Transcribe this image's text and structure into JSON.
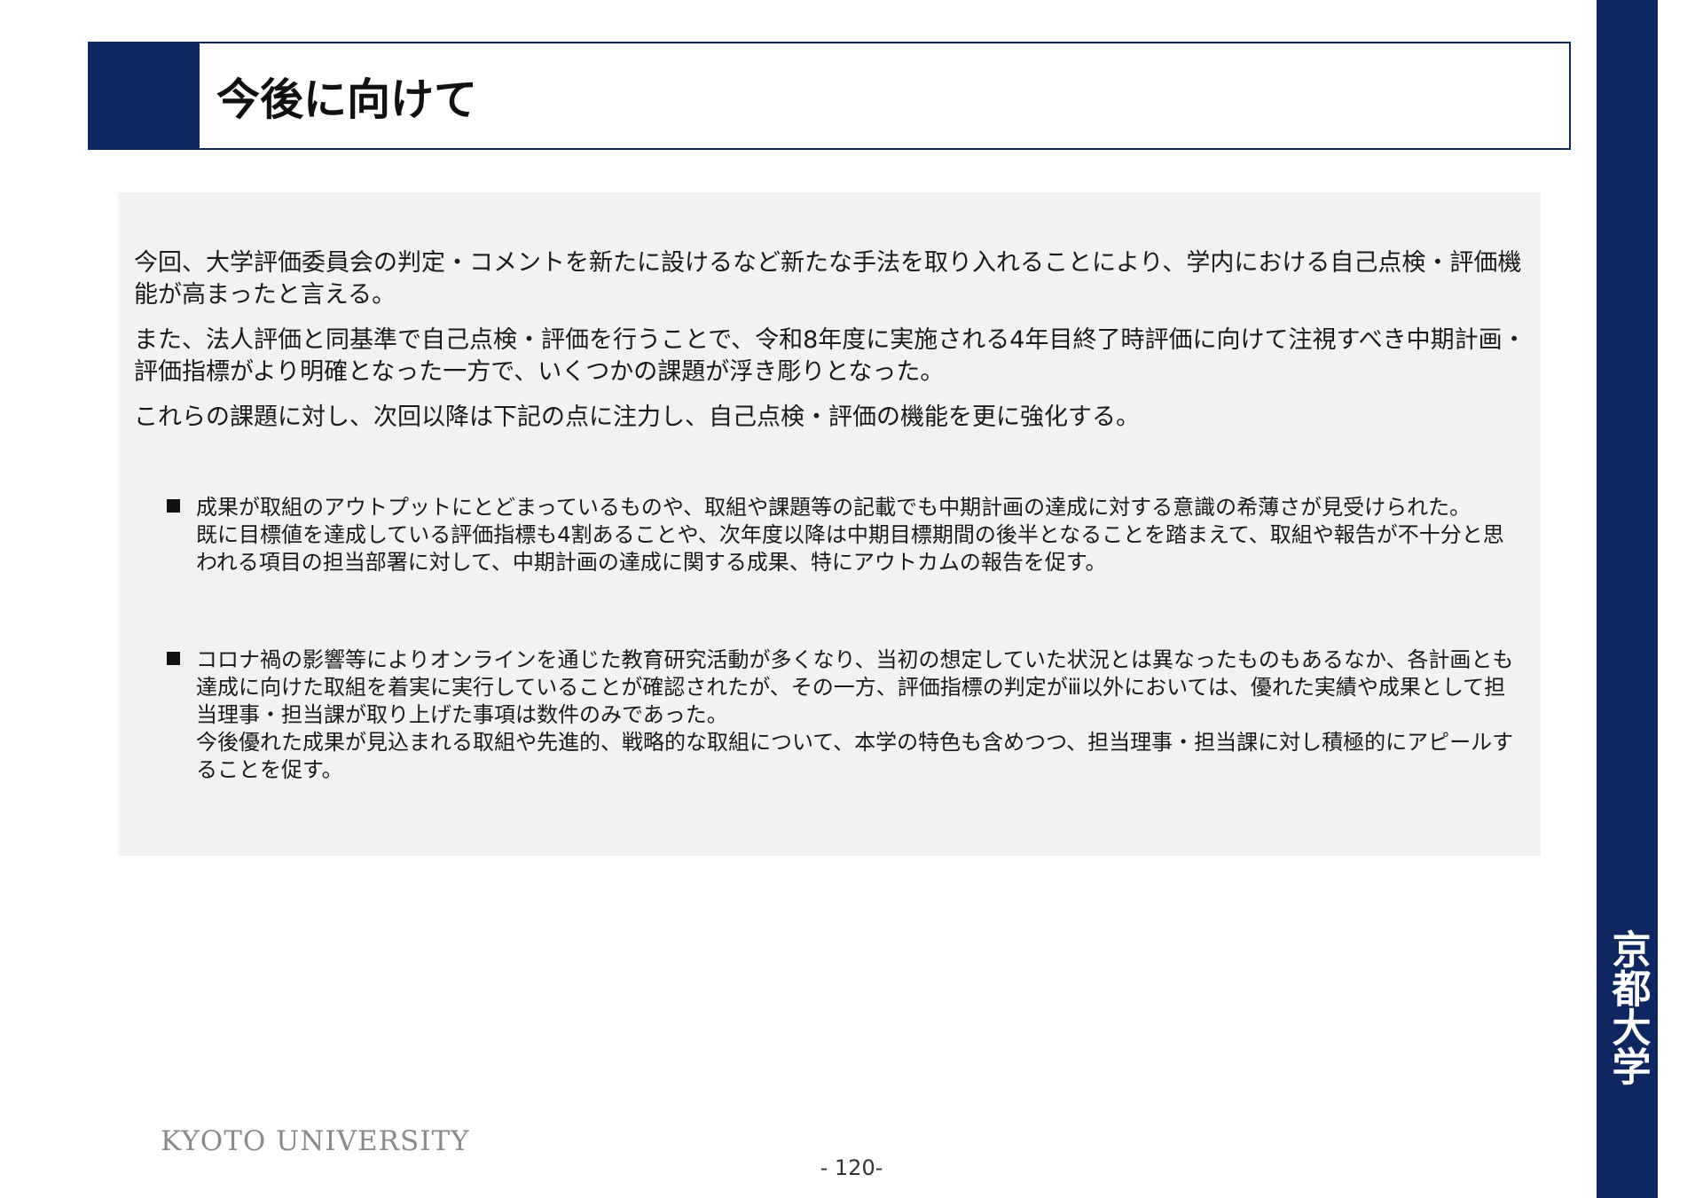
{
  "header": {
    "title": "今後に向けて"
  },
  "sidebar": {
    "university_name": "京都大学"
  },
  "content": {
    "paragraphs": [
      "今回、大学評価委員会の判定・コメントを新たに設けるなど新たな手法を取り入れることにより、学内における自己点検・評価機能が高まったと言える。",
      "また、法人評価と同基準で自己点検・評価を行うことで、令和8年度に実施される4年目終了時評価に向けて注視すべき中期計画・評価指標がより明確となった一方で、いくつかの課題が浮き彫りとなった。",
      "これらの課題に対し、次回以降は下記の点に注力し、自己点検・評価の機能を更に強化する。"
    ],
    "bullets": [
      {
        "lines": [
          "成果が取組のアウトプットにとどまっているものや、取組や課題等の記載でも中期計画の達成に対する意識の希薄さが見受けられた。",
          "既に目標値を達成している評価指標も4割あることや、次年度以降は中期目標期間の後半となることを踏まえて、取組や報告が不十分と思われる項目の担当部署に対して、中期計画の達成に関する成果、特にアウトカムの報告を促す。"
        ]
      },
      {
        "lines": [
          "コロナ禍の影響等によりオンラインを通じた教育研究活動が多くなり、当初の想定していた状況とは異なったものもあるなか、各計画とも達成に向けた取組を着実に実行していることが確認されたが、その一方、評価指標の判定がⅲ以外においては、優れた実績や成果として担当理事・担当課が取り上げた事項は数件のみであった。",
          "今後優れた成果が見込まれる取組や先進的、戦略的な取組について、本学の特色も含めつつ、担当理事・担当課に対し積極的にアピールすることを促す。"
        ]
      }
    ]
  },
  "footer": {
    "logo_text": "KYOTO UNIVERSITY",
    "page_number": "- 120-"
  }
}
